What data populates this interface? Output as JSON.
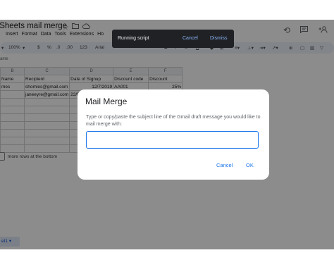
{
  "app": {
    "title": "/Sheets mail merge",
    "menu": [
      "Insert",
      "Format",
      "Data",
      "Tools",
      "Extensions",
      "Ho"
    ],
    "title_icons": [
      "star-icon",
      "folder-move-icon",
      "cloud-status-icon"
    ],
    "right_icons": [
      "history-icon",
      "comment-icon",
      "add-person-icon"
    ]
  },
  "toolbar": {
    "zoom": "100%",
    "currency": "$",
    "percent": "%",
    "dec_decrease": ".0",
    "dec_increase": ".00",
    "number_format": "123",
    "font": "Arial",
    "bold": "B"
  },
  "name_box": "ame",
  "sheet": {
    "col_headers": [
      "B",
      "C",
      "D",
      "E",
      "F"
    ],
    "header_row": [
      "Name",
      "Recipient",
      "Date of Signup",
      "Discount code",
      "Discount"
    ],
    "rows": [
      [
        "mes",
        "shomles@gmail.com",
        "12/7/2019",
        "AA001",
        "25%"
      ],
      [
        "",
        "janeeyre@gmail.com",
        "23/9",
        "",
        ""
      ],
      [
        "",
        "",
        "",
        "",
        ""
      ],
      [
        "",
        "",
        "",
        "",
        ""
      ],
      [
        "",
        "",
        "",
        "",
        ""
      ],
      [
        "",
        "",
        "",
        "",
        ""
      ],
      [
        "",
        "",
        "",
        "",
        ""
      ],
      [
        "",
        "",
        "",
        "",
        ""
      ],
      [
        "",
        "",
        "",
        "",
        ""
      ]
    ],
    "add_rows_text": "more rows at the bottom",
    "sheet_tab": "et1",
    "sheet_tab_caret": "▾"
  },
  "toast": {
    "message": "Running script",
    "cancel": "Cancel",
    "dismiss": "Dismiss"
  },
  "dialog": {
    "title": "Mail Merge",
    "message": "Type or copy/paste the subject line of the Gmail draft message you would like to mail merge with:",
    "input_value": "",
    "cancel": "Cancel",
    "ok": "OK"
  }
}
